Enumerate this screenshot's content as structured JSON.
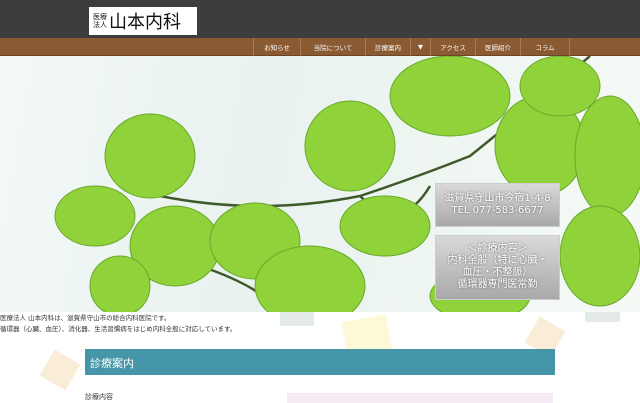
{
  "logo": {
    "small": "医療法人",
    "big": "山本内科"
  },
  "nav": [
    "お知らせ",
    "当院について",
    "診療案内",
    "▼",
    "アクセス",
    "医師紹介",
    "コラム"
  ],
  "hero": {
    "address": "滋賀県守山市今宿1-4-8",
    "tel": "TEL 077-583-6677",
    "services_title": "＜診療内容＞",
    "services_1": "内科全般（特に心臓・",
    "services_2": "血圧・不整脈）",
    "services_3": "循環器専門医常勤"
  },
  "intro": [
    "医療法人 山本内科は、滋賀県守山市の総合内科医院です。",
    "循環器（心臓、血圧）、消化器、生活習慣病をはじめ内科全般に対応しています。"
  ],
  "section": {
    "title": "診療案内",
    "sub": "診療内容"
  }
}
